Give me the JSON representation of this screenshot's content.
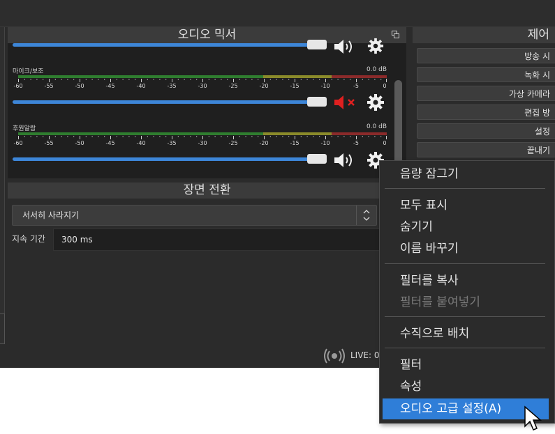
{
  "colors": {
    "background": "#2b2b2b",
    "dock_title": "#3b3b3b",
    "accent": "#2f7ed8",
    "slider": "#3d86d8",
    "muted_icon": "#e02020",
    "meter_green": "#2f7d2f",
    "meter_yellow": "#8a8a2a",
    "meter_red": "#8a2a2a"
  },
  "mixer": {
    "title": "오디오 믹서",
    "scale_ticks": [
      "-60",
      "-55",
      "-50",
      "-45",
      "-40",
      "-35",
      "-30",
      "-25",
      "-20",
      "-15",
      "-10",
      "-5",
      "0"
    ],
    "channels": [
      {
        "name": "마이크/보조",
        "level": "0.0 dB",
        "muted": true,
        "volume": 0.98
      },
      {
        "name": "후원알람",
        "level": "0.0 dB",
        "muted": false,
        "volume": 0.98
      }
    ],
    "top_channel": {
      "muted": false,
      "volume": 0.98
    }
  },
  "transition": {
    "title": "장면 전환",
    "selected": "서서히 사라지기",
    "duration_label": "지속 기간",
    "duration_value": "300 ms"
  },
  "controls": {
    "title": "제어",
    "buttons": [
      "방송 시",
      "녹화 시",
      "가상 카메라",
      "편집 방",
      "설정",
      "끝내기"
    ]
  },
  "status": {
    "live": "LIVE: 0"
  },
  "context_menu": {
    "items": [
      {
        "label": "음량 잠그기"
      },
      {
        "label": "모두 표시"
      },
      {
        "label": "숨기기"
      },
      {
        "label": "이름 바꾸기"
      },
      {
        "label": "필터를 복사"
      },
      {
        "label": "필터를 붙여넣기",
        "disabled": true
      },
      {
        "label": "수직으로 배치"
      },
      {
        "label": "필터"
      },
      {
        "label": "속성"
      },
      {
        "label": "오디오 고급 설정(A)",
        "active": true
      }
    ]
  }
}
